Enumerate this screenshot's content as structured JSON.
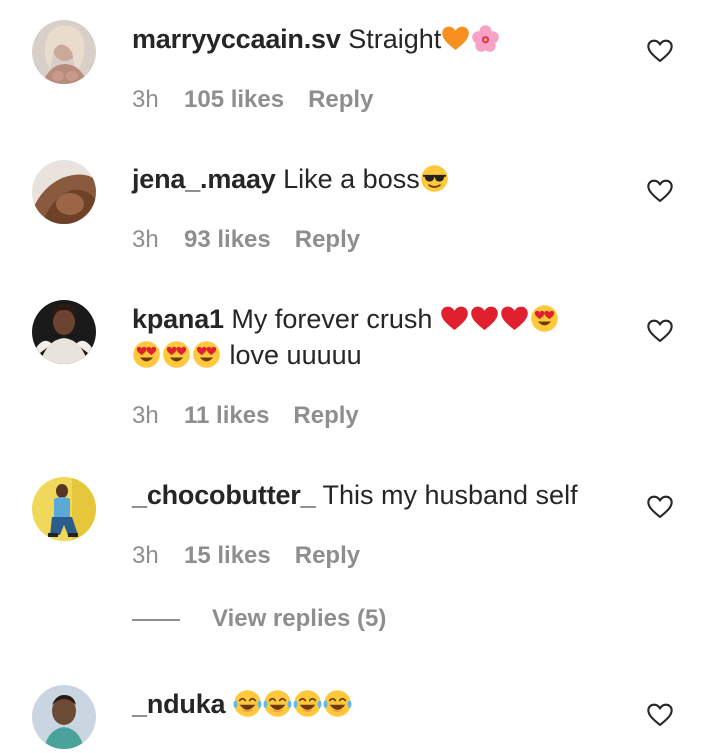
{
  "comments": [
    {
      "username": "marryyccaain.sv",
      "text": "Straight",
      "time": "3h",
      "likes": "105 likes",
      "reply": "Reply",
      "emojis": [
        "orange-heart",
        "hibiscus"
      ]
    },
    {
      "username": "jena_.maay",
      "text": "Like a boss",
      "time": "3h",
      "likes": "93 likes",
      "reply": "Reply",
      "emojis": [
        "sunglasses-face"
      ]
    },
    {
      "username": "kpana1",
      "text": "My forever crush",
      "text2": "love uuuuu",
      "time": "3h",
      "likes": "11 likes",
      "reply": "Reply",
      "emojis": [
        "red-heart",
        "red-heart",
        "red-heart",
        "heart-eyes-face",
        "heart-eyes-face",
        "heart-eyes-face",
        "heart-eyes-face"
      ]
    },
    {
      "username": "_chocobutter_",
      "text": "This my husband self",
      "time": "3h",
      "likes": "15 likes",
      "reply": "Reply",
      "view_replies": "View replies (5)"
    },
    {
      "username": "_nduka",
      "text": "",
      "emojis": [
        "tears-of-joy-face",
        "tears-of-joy-face",
        "tears-of-joy-face",
        "tears-of-joy-face"
      ]
    }
  ],
  "colors": {
    "text": "#262626",
    "meta": "#8e8e8e",
    "heart_red": "#e0202e",
    "emoji_yellow": "#ffc83d"
  }
}
